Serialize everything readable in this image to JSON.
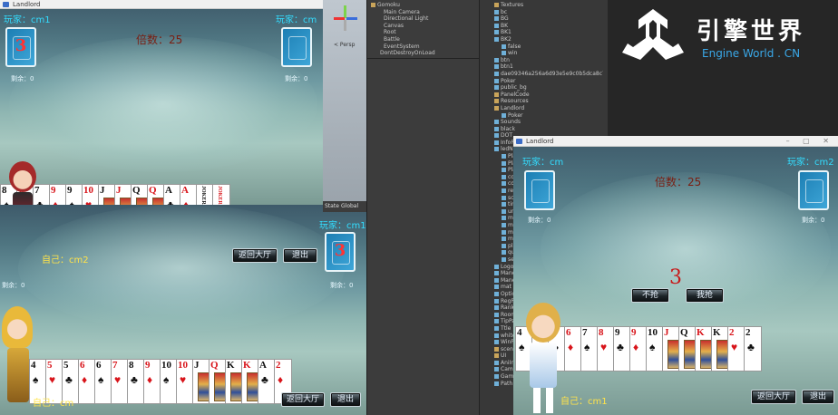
{
  "left_window": {
    "title": "Landlord",
    "top": {
      "player_left_label": "玩家：cm1",
      "player_right_label": "玩家：cm",
      "multiplier": "倍数：25",
      "left_count": "剩余：0",
      "right_count": "剩余：0",
      "left_card_number": "3",
      "hand": [
        "8",
        "7",
        "7",
        "9",
        "9",
        "10",
        "J",
        "J",
        "Q",
        "Q",
        "A",
        "A",
        "JOKER",
        "JOKER"
      ],
      "self_label": "自己：cm2",
      "btn_back": "返回大厅",
      "btn_exit": "退出",
      "right_player2": "玩家：cm1",
      "right_card_number": "3",
      "left_count2": "剩余：0",
      "right_count2": "剩余：0"
    },
    "bottom": {
      "hand": [
        "4",
        "5",
        "5",
        "6",
        "6",
        "7",
        "8",
        "9",
        "10",
        "10",
        "J",
        "Q",
        "K",
        "K",
        "A",
        "2"
      ],
      "self_label": "自己：",
      "self_name": "cm",
      "btn_back": "返回大厅",
      "btn_exit": "退出"
    }
  },
  "scene_tabs": {
    "persp": "< Persp",
    "state": "State",
    "globals": "Global"
  },
  "hierarchy": {
    "root": "Gomoku",
    "items": [
      "Main Camera",
      "Directional Light",
      "Canvas",
      "Root",
      "Battle",
      "EventSystem",
      "DontDestroyOnLoad"
    ]
  },
  "project": {
    "items": [
      "Textures",
      "bc",
      "BG",
      "BK",
      "BK1",
      "BK2",
      "false",
      "win",
      "btn",
      "btn1",
      "dae09346a256a6d93e5e9c0b5dca8c7",
      "Poker",
      "public_bg",
      "PanelCode",
      "Resources",
      "Landlord",
      "Poker",
      "Sounds",
      "black",
      "DOT",
      "InfoP",
      "ledN",
      "Pla",
      "Pla",
      "Pla",
      "co",
      "co",
      "re",
      "sc",
      "tin",
      "un",
      "mi",
      "mi",
      "mi",
      "mi",
      "pla",
      "qu",
      "se",
      "Logo",
      "Mane",
      "Mane",
      "mat",
      "Optio",
      "RegP",
      "Rank",
      "Room",
      "TipPa",
      "Ttle",
      "white",
      "WinP",
      "scene",
      "UI",
      "AniIn",
      "Camera",
      "GameM",
      "Path"
    ]
  },
  "logo": {
    "cn": "引擎世界",
    "en": "Engine World . CN"
  },
  "right_window": {
    "title": "Landlord",
    "player_left_label": "玩家：cm",
    "player_right_label": "玩家：cm2",
    "multiplier": "倍数：25",
    "left_count": "剩余：0",
    "right_count": "剩余：0",
    "big_number": "3",
    "btn_no": "不抢",
    "btn_grab": "我抢",
    "hand": [
      "4",
      "5",
      "6",
      "6",
      "7",
      "8",
      "9",
      "9",
      "10",
      "J",
      "Q",
      "K",
      "K",
      "2",
      "2"
    ],
    "self_label": "自己：cm1",
    "btn_back": "返回大厅",
    "btn_exit": "退出"
  },
  "colors": {
    "cyan": "#33ddff",
    "yellow": "#ffe34a",
    "red": "#d8141a",
    "multiplier": "#7a1e12"
  }
}
